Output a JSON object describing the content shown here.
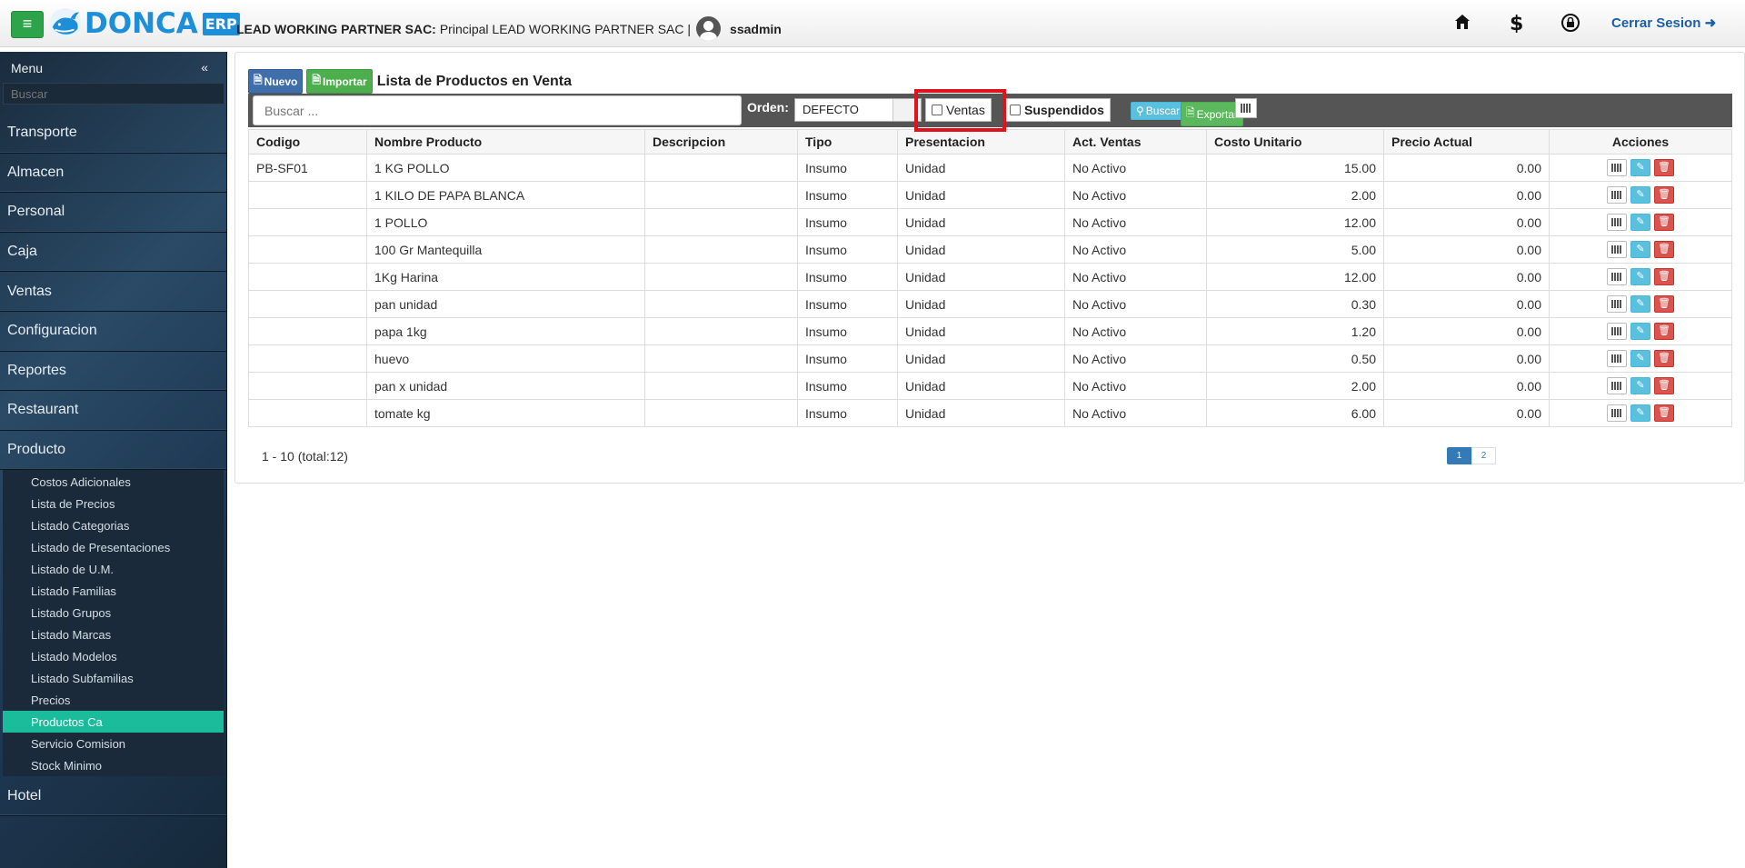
{
  "header": {
    "brand": "DONCA",
    "brand_suffix": "ERP",
    "company_bold": "LEAD WORKING PARTNER SAC:",
    "company_rest": "Principal LEAD WORKING PARTNER SAC |",
    "username": "ssadmin",
    "logout_label": "Cerrar Sesion",
    "icons": [
      "home-icon",
      "dollar-icon",
      "lock-icon",
      "sign-out-icon"
    ]
  },
  "sidebar": {
    "title": "Menu",
    "search_placeholder": "Buscar",
    "items": [
      {
        "label": "Transporte"
      },
      {
        "label": "Almacen"
      },
      {
        "label": "Personal"
      },
      {
        "label": "Caja"
      },
      {
        "label": "Ventas"
      },
      {
        "label": "Configuracion"
      },
      {
        "label": "Reportes"
      },
      {
        "label": "Restaurant"
      },
      {
        "label": "Producto"
      }
    ],
    "subitems": [
      "Costos Adicionales",
      "Lista de Precios",
      "Listado Categorias",
      "Listado de Presentaciones",
      "Listado de U.M.",
      "Listado Familias",
      "Listado Grupos",
      "Listado Marcas",
      "Listado Modelos",
      "Listado Subfamilias",
      "Precios",
      "Productos Ca",
      "Servicio Comision",
      "Stock Minimo"
    ],
    "active_subitem": "Productos Ca",
    "after_item": "Hotel"
  },
  "main": {
    "new_label": "Nuevo",
    "import_label": "Importar",
    "title": "Lista de Productos en Venta",
    "search_placeholder": "Buscar ...",
    "order_label": "Orden:",
    "order_value": "DEFECTO",
    "ventas_label": "Ventas",
    "suspendidos_label": "Suspendidos",
    "buscar_label": "Buscar",
    "exportar_label": "Exportar",
    "columns": [
      "Codigo",
      "Nombre Producto",
      "Descripcion",
      "Tipo",
      "Presentacion",
      "Act. Ventas",
      "Costo Unitario",
      "Precio Actual",
      "Acciones"
    ],
    "rows": [
      [
        "PB-SF01",
        "1 KG POLLO",
        "",
        "Insumo",
        "Unidad",
        "No Activo",
        "15.00",
        "0.00"
      ],
      [
        "",
        "1 KILO DE PAPA BLANCA",
        "",
        "Insumo",
        "Unidad",
        "No Activo",
        "2.00",
        "0.00"
      ],
      [
        "",
        "1 POLLO",
        "",
        "Insumo",
        "Unidad",
        "No Activo",
        "12.00",
        "0.00"
      ],
      [
        "",
        "100 Gr Mantequilla",
        "",
        "Insumo",
        "Unidad",
        "No Activo",
        "5.00",
        "0.00"
      ],
      [
        "",
        "1Kg Harina",
        "",
        "Insumo",
        "Unidad",
        "No Activo",
        "12.00",
        "0.00"
      ],
      [
        "",
        "pan unidad",
        "",
        "Insumo",
        "Unidad",
        "No Activo",
        "0.30",
        "0.00"
      ],
      [
        "",
        "papa 1kg",
        "",
        "Insumo",
        "Unidad",
        "No Activo",
        "1.20",
        "0.00"
      ],
      [
        "",
        "huevo",
        "",
        "Insumo",
        "Unidad",
        "No Activo",
        "0.50",
        "0.00"
      ],
      [
        "",
        "pan x unidad",
        "",
        "Insumo",
        "Unidad",
        "No Activo",
        "2.00",
        "0.00"
      ],
      [
        "",
        "tomate kg",
        "",
        "Insumo",
        "Unidad",
        "No Activo",
        "6.00",
        "0.00"
      ]
    ],
    "pager_info": "1 - 10 (total:12)",
    "pages": [
      "1",
      "2"
    ],
    "active_page": "1"
  },
  "colors": {
    "accent_green": "#2ea44a",
    "brand_blue": "#1d8ed8",
    "active_item": "#1abc9c",
    "highlight_red": "#e0131c"
  }
}
